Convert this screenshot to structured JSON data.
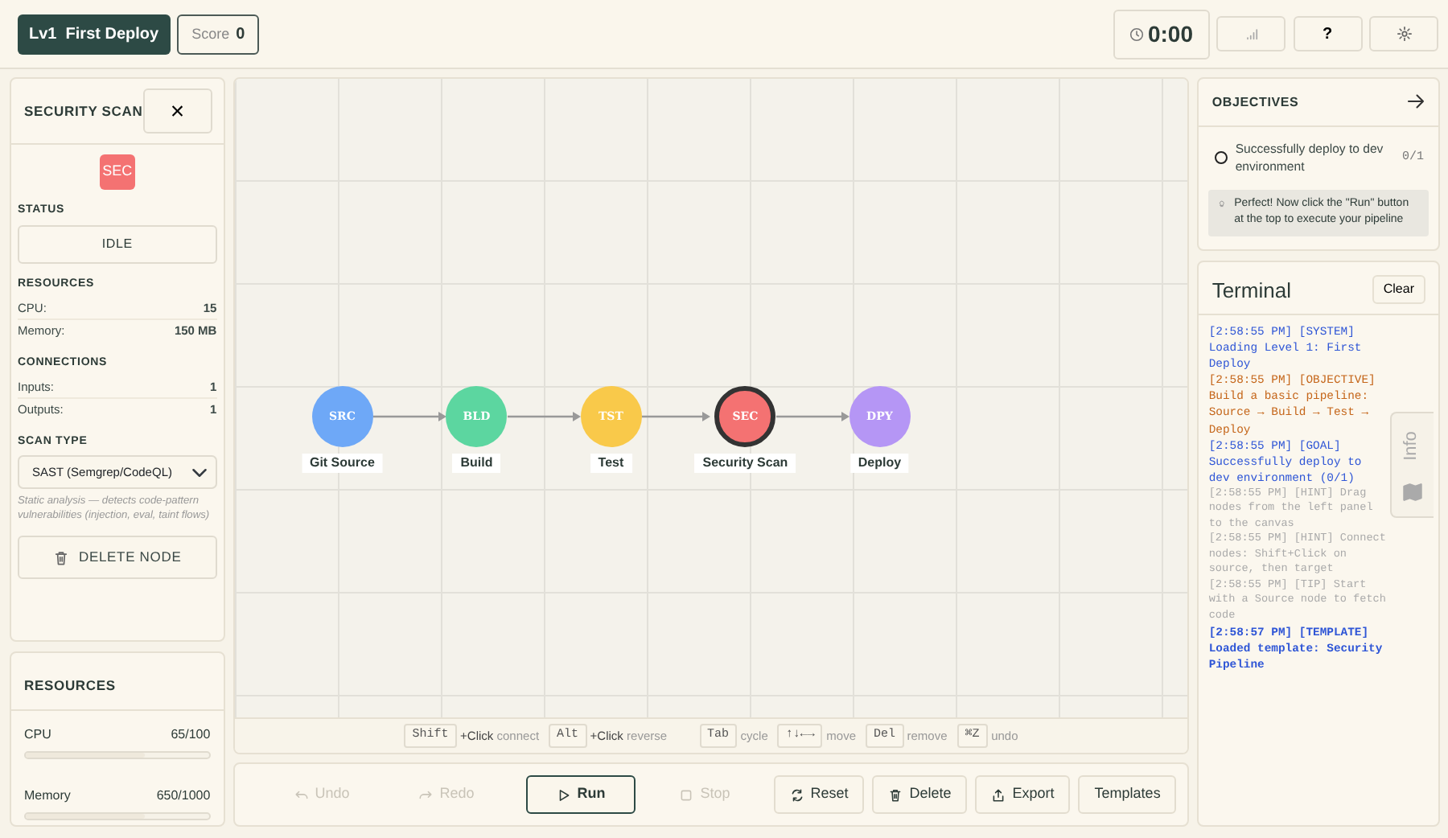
{
  "header": {
    "level": "Lv1",
    "level_title": "First Deploy",
    "score_label": "Score",
    "score": "0",
    "timer": "0:00",
    "help": "?"
  },
  "properties": {
    "title": "SECURITY SCAN",
    "close": "×",
    "badge": {
      "text": "SEC",
      "color": "#f47272"
    },
    "status_heading": "STATUS",
    "status": "IDLE",
    "resources_heading": "RESOURCES",
    "resources": [
      {
        "label": "CPU:",
        "value": "15"
      },
      {
        "label": "Memory:",
        "value": "150 MB"
      }
    ],
    "connections_heading": "CONNECTIONS",
    "connections": [
      {
        "label": "Inputs:",
        "value": "1"
      },
      {
        "label": "Outputs:",
        "value": "1"
      }
    ],
    "scan_heading": "SCAN TYPE",
    "scan_type": "SAST (Semgrep/CodeQL)",
    "scan_note": "Static analysis — detects code-pattern vulnerabilities (injection, eval, taint flows)",
    "delete": "DELETE NODE"
  },
  "resources": {
    "title": "RESOURCES",
    "meters": [
      {
        "label": "CPU",
        "reading": "65/100",
        "level": 0.65
      },
      {
        "label": "Memory",
        "reading": "650/1000",
        "level": 0.65
      }
    ]
  },
  "canvas": {
    "nodes": [
      {
        "abbr": "SRC",
        "label": "Git Source",
        "color": "#6ea8f7",
        "selected": false
      },
      {
        "abbr": "BLD",
        "label": "Build",
        "color": "#5cd6a0",
        "selected": false
      },
      {
        "abbr": "TST",
        "label": "Test",
        "color": "#f9c94a",
        "selected": false
      },
      {
        "abbr": "SEC",
        "label": "Security Scan",
        "color": "#f47272",
        "selected": true
      },
      {
        "abbr": "DPY",
        "label": "Deploy",
        "color": "#b596f5",
        "selected": false
      }
    ],
    "shortcuts": [
      {
        "key": "Shift",
        "action": "+Click",
        "desc": "connect"
      },
      {
        "key": "Alt",
        "action": "+Click",
        "desc": "reverse"
      },
      {
        "key": "Tab",
        "desc": "cycle"
      },
      {
        "key": "↑↓←→",
        "desc": "move"
      },
      {
        "key": "Del",
        "desc": "remove"
      },
      {
        "key": "⌘Z",
        "desc": "undo"
      }
    ]
  },
  "toolbar": [
    {
      "kind": "undo",
      "label": "Undo",
      "disabled": true
    },
    {
      "kind": "redo",
      "label": "Redo",
      "disabled": true
    },
    {
      "kind": "run",
      "label": "Run",
      "disabled": false
    },
    {
      "kind": "stop",
      "label": "Stop",
      "disabled": true
    },
    {
      "kind": "reset",
      "label": "Reset",
      "disabled": false
    },
    {
      "kind": "delete",
      "label": "Delete",
      "disabled": false
    },
    {
      "kind": "export",
      "label": "Export",
      "disabled": false
    },
    {
      "kind": "templates",
      "label": "Templates",
      "disabled": false
    }
  ],
  "objectives": {
    "title": "OBJECTIVES",
    "items": [
      {
        "text": "Successfully deploy to dev environment",
        "progress": "0/1",
        "done": false
      }
    ],
    "tip": "Perfect! Now click the \"Run\" button at the top to execute your pipeline"
  },
  "terminal": {
    "title": "Terminal",
    "clear": "Clear",
    "lines": [
      {
        "kind": "system",
        "text": "[2:58:55 PM] [SYSTEM] Loading Level 1: First Deploy"
      },
      {
        "kind": "objective",
        "text": "[2:58:55 PM] [OBJECTIVE] Build a basic pipeline: Source → Build → Test → Deploy"
      },
      {
        "kind": "goal",
        "text": "[2:58:55 PM] [GOAL] Successfully deploy to dev environment (0/1)"
      },
      {
        "kind": "hint",
        "text": "[2:58:55 PM] [HINT] Drag nodes from the left panel to the canvas"
      },
      {
        "kind": "hint",
        "text": "[2:58:55 PM] [HINT] Connect nodes: Shift+Click on source, then target"
      },
      {
        "kind": "tip",
        "text": "[2:58:55 PM] [TIP] Start with a Source node to fetch code"
      },
      {
        "kind": "template",
        "text": "[2:58:57 PM] [TEMPLATE] Loaded template: Security Pipeline"
      }
    ]
  },
  "info_tab": "Info"
}
